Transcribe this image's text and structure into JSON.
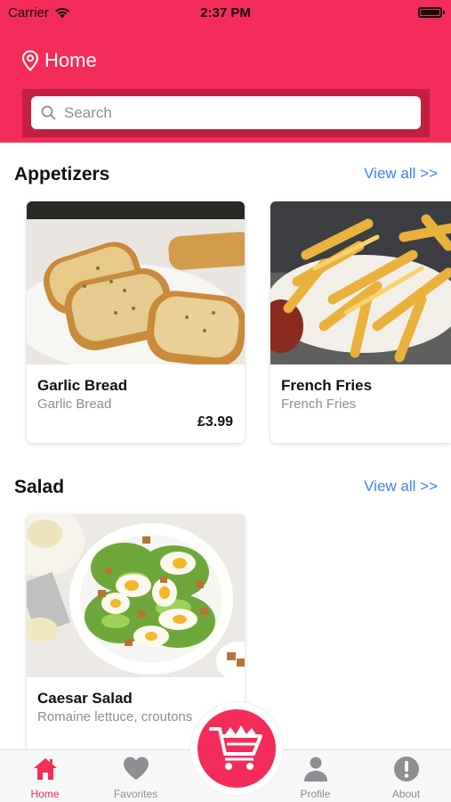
{
  "status_bar": {
    "carrier": "Carrier",
    "time": "2:37 PM"
  },
  "header": {
    "location_label": "Home"
  },
  "search": {
    "placeholder": "Search",
    "value": ""
  },
  "sections": [
    {
      "title": "Appetizers",
      "view_all": "View all >>",
      "items": [
        {
          "name": "Garlic Bread",
          "description": "Garlic Bread",
          "price": "£3.99"
        },
        {
          "name": "French Fries",
          "description": "French Fries",
          "price": ""
        }
      ]
    },
    {
      "title": "Salad",
      "view_all": "View all >>",
      "items": [
        {
          "name": "Caesar Salad",
          "description": "Romaine lettuce, croutons",
          "price": ""
        }
      ]
    }
  ],
  "tabbar": {
    "tabs": [
      {
        "label": "Home",
        "icon": "home-icon",
        "active": true
      },
      {
        "label": "Favorites",
        "icon": "heart-icon",
        "active": false
      },
      {
        "label": "Profile",
        "icon": "person-icon",
        "active": false
      },
      {
        "label": "About",
        "icon": "info-icon",
        "active": false
      }
    ],
    "cart_icon": "cart-icon"
  },
  "colors": {
    "brand": "#f42c5a",
    "link": "#3b82f6",
    "muted": "#8e8e93"
  }
}
